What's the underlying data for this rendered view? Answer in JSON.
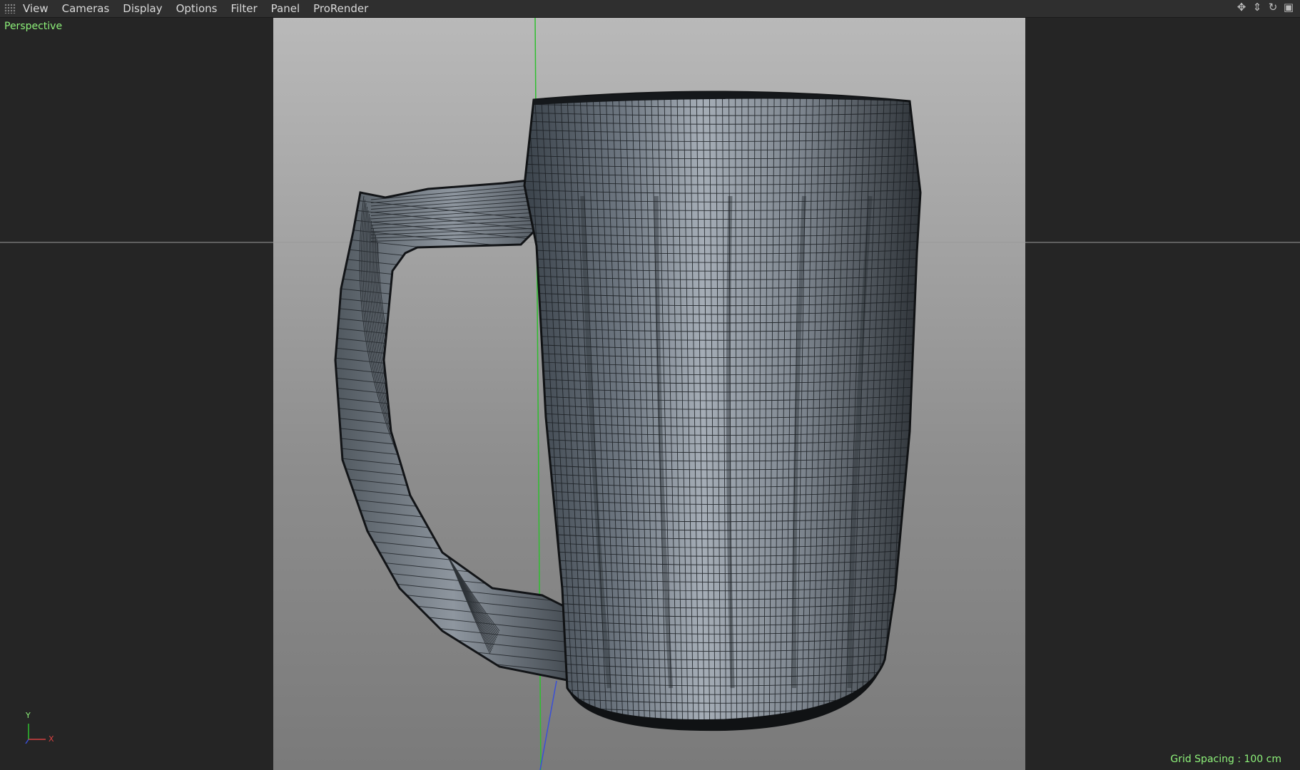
{
  "menubar": {
    "items": [
      "View",
      "Cameras",
      "Display",
      "Options",
      "Filter",
      "Panel",
      "ProRender"
    ],
    "nav_icons": [
      "move-view-icon",
      "dolly-view-icon",
      "rotate-view-icon",
      "toggle-layout-icon"
    ]
  },
  "viewport": {
    "camera_label": "Perspective",
    "grid_spacing": "Grid Spacing : 100 cm",
    "axis_labels": {
      "y": "Y",
      "x": "X"
    },
    "colors": {
      "hud_text": "#8ef27a",
      "y_axis": "#2fbf2f",
      "z_axis": "#3a4fd6",
      "x_axis": "#d84040",
      "horizon": "#9a9a9a"
    }
  }
}
